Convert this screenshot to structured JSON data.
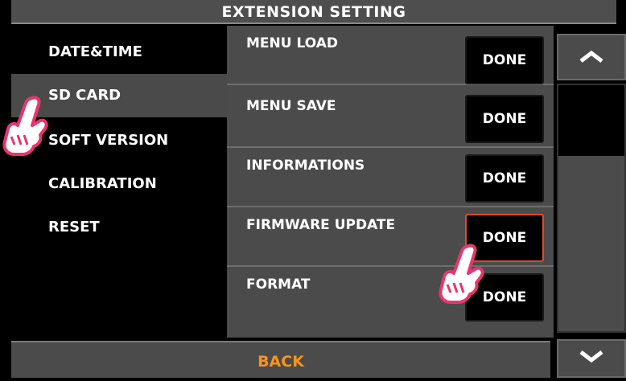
{
  "header": {
    "title": "EXTENSION SETTING"
  },
  "left_menu": {
    "items": [
      {
        "label": "DATE&TIME"
      },
      {
        "label": "SD CARD"
      },
      {
        "label": "SOFT VERSION"
      },
      {
        "label": "CALIBRATION"
      },
      {
        "label": "RESET"
      }
    ],
    "active_item": "SD CARD"
  },
  "options": [
    {
      "label": "MENU LOAD",
      "button": "DONE"
    },
    {
      "label": "MENU SAVE",
      "button": "DONE"
    },
    {
      "label": "INFORMATIONS",
      "button": "DONE"
    },
    {
      "label": "FIRMWARE UPDATE",
      "button": "DONE"
    },
    {
      "label": "FORMAT",
      "button": "DONE"
    }
  ],
  "highlighted_option": "FIRMWARE UPDATE",
  "footer": {
    "back_label": "BACK"
  },
  "colors": {
    "accent": "#f7941d",
    "highlight_border": "#e04a2a",
    "panel": "#4b4b4b",
    "hand": "#e8356d"
  },
  "icons": {
    "scroll_up": "chevron-up-icon",
    "scroll_down": "chevron-down-icon",
    "pointer": "hand-pointer-icon"
  }
}
